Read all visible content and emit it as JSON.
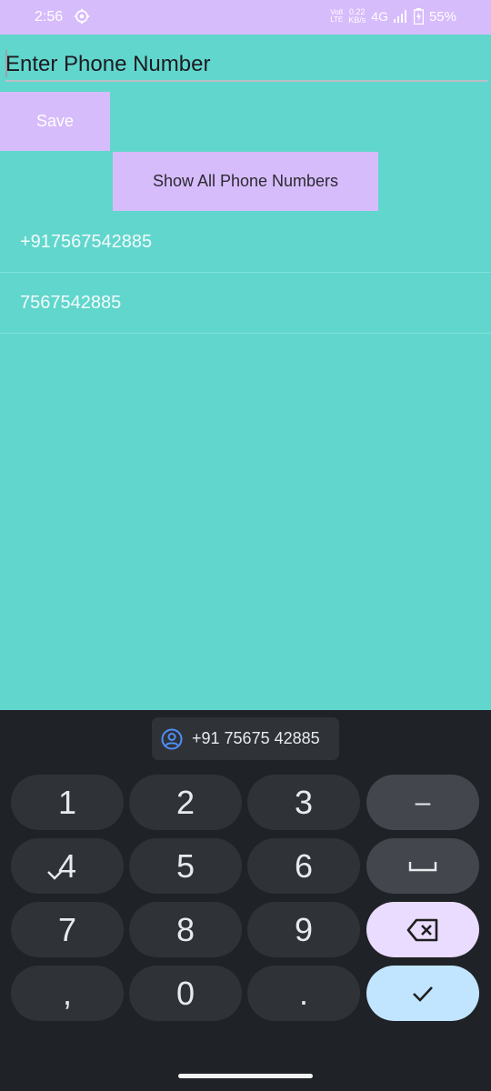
{
  "status_bar": {
    "time": "2:56",
    "volte_top": "Vo8",
    "volte_bottom": "LTE",
    "net_speed_top": "0.22",
    "net_speed_bottom": "KB/s",
    "network": "4G",
    "battery": "55%"
  },
  "form": {
    "placeholder": "Enter Phone Number",
    "save_label": "Save",
    "show_all_label": "Show All Phone Numbers"
  },
  "list": {
    "items": [
      "+917567542885",
      "7567542885"
    ]
  },
  "keyboard": {
    "suggestion": "+91 75675 42885",
    "keys": [
      "1",
      "2",
      "3",
      "–",
      "4",
      "5",
      "6",
      "␣",
      "7",
      "8",
      "9",
      "⌫",
      ",",
      "0",
      ".",
      "✓"
    ]
  },
  "colors": {
    "background": "#61d6cd",
    "accent": "#d7bcfb",
    "keyboard_bg": "#1f2226"
  }
}
